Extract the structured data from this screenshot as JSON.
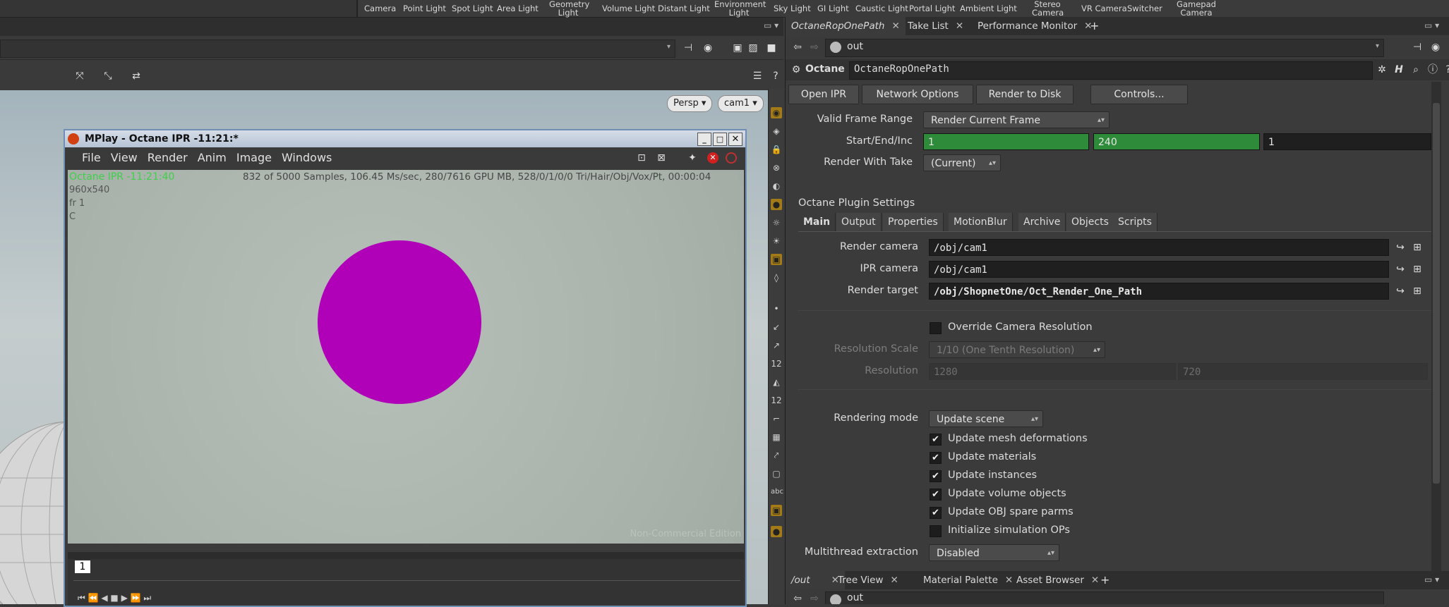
{
  "shelf": {
    "tools": [
      "Camera",
      "Point Light",
      "Spot Light",
      "Area Light",
      "Geometry Light",
      "Volume Light",
      "Distant Light",
      "Environment Light",
      "Sky Light",
      "GI Light",
      "Caustic Light",
      "Portal Light",
      "Ambient Light",
      "Stereo Camera",
      "VR Camera",
      "Switcher",
      "Gamepad Camera"
    ]
  },
  "viewport": {
    "persp_label": "Persp",
    "camera_label": "cam1"
  },
  "mplay": {
    "title": "MPlay - Octane IPR -11:21:*",
    "menu": [
      "File",
      "View",
      "Render",
      "Anim",
      "Image",
      "Windows"
    ],
    "info_title": "Octane IPR -11:21:40",
    "info_res": "960x540",
    "info_frame": "fr 1",
    "info_channel": "C",
    "stats": "832 of 5000 Samples, 106.45 Ms/sec, 280/7616 GPU MB, 528/0/1/0/0 Tri/Hair/Obj/Vox/Pt, 00:00:04",
    "watermark": "Non-Commercial Edition",
    "frame_num": "1",
    "sphere_color": "#b000b8"
  },
  "rpane": {
    "top_tabs": [
      {
        "label": "OctaneRopOnePath",
        "active": true
      },
      {
        "label": "Take List",
        "active": false
      },
      {
        "label": "Performance Monitor",
        "active": false
      }
    ],
    "path": "out",
    "node_type": "Octane",
    "node_name": "OctaneRopOnePath",
    "buttons": [
      "Open IPR",
      "Network Options",
      "Render to Disk",
      "Controls..."
    ],
    "valid_frame_range_label": "Valid Frame Range",
    "valid_frame_range_value": "Render Current Frame",
    "start_end_label": "Start/End/Inc",
    "start": "1",
    "end": "240",
    "inc": "1",
    "render_with_take_label": "Render With Take",
    "render_with_take_value": "(Current)",
    "plugin_settings_label": "Octane Plugin Settings",
    "sub_tabs": [
      {
        "label": "Main",
        "active": true
      },
      {
        "label": "Output",
        "active": false
      },
      {
        "label": "Properties",
        "active": false
      },
      {
        "label": "MotionBlur",
        "active": false
      },
      {
        "label": "Archive",
        "active": false
      },
      {
        "label": "Objects",
        "active": false
      },
      {
        "label": "Scripts",
        "active": false
      }
    ],
    "render_camera_label": "Render camera",
    "render_camera_value": "/obj/cam1",
    "ipr_camera_label": "IPR camera",
    "ipr_camera_value": "/obj/cam1",
    "render_target_label": "Render target",
    "render_target_value": "/obj/ShopnetOne/Oct_Render_One_Path",
    "override_cam_res_label": "Override Camera Resolution",
    "resolution_scale_label": "Resolution Scale",
    "resolution_scale_value": "1/10 (One Tenth Resolution)",
    "resolution_label": "Resolution",
    "res_x": "1280",
    "res_y": "720",
    "rendering_mode_label": "Rendering mode",
    "rendering_mode_value": "Update scene",
    "checks": [
      {
        "label": "Update mesh deformations",
        "checked": true
      },
      {
        "label": "Update materials",
        "checked": true
      },
      {
        "label": "Update instances",
        "checked": true
      },
      {
        "label": "Update volume objects",
        "checked": true
      },
      {
        "label": "Update OBJ spare parms",
        "checked": true
      },
      {
        "label": "Initialize simulation OPs",
        "checked": false
      }
    ],
    "multithread_label": "Multithread extraction",
    "multithread_value": "Disabled",
    "bottom_tabs": [
      {
        "label": "/out",
        "active": true
      },
      {
        "label": "Tree View",
        "active": false
      },
      {
        "label": "Material Palette",
        "active": false
      },
      {
        "label": "Asset Browser",
        "active": false
      }
    ],
    "bottom_path": "out"
  }
}
